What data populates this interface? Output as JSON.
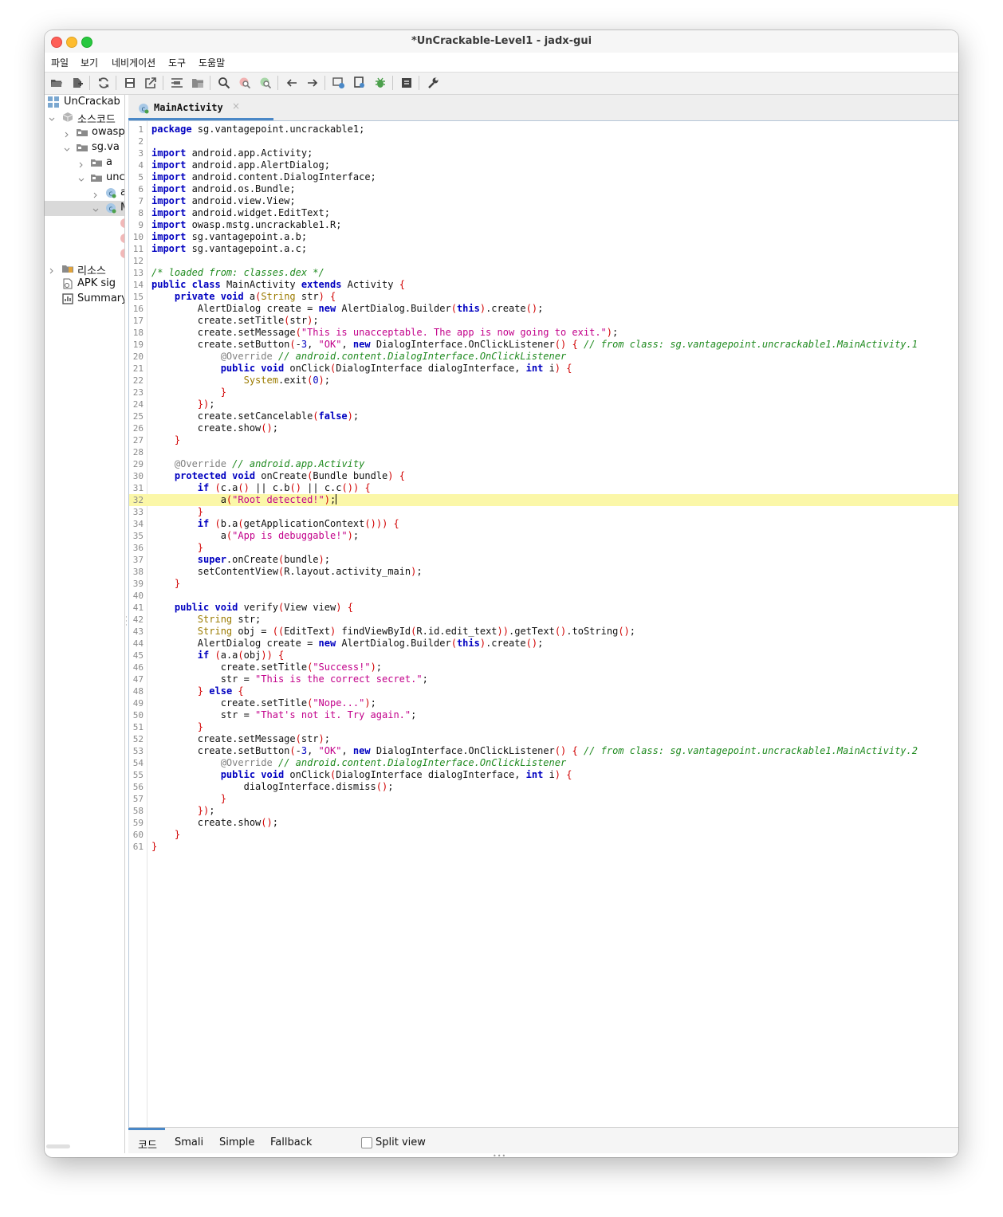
{
  "window": {
    "title": "*UnCrackable-Level1 - jadx-gui"
  },
  "menu": [
    "파일",
    "보기",
    "네비게이션",
    "도구",
    "도움말"
  ],
  "toolbar_icons": [
    "open-file-icon",
    "add-file-icon",
    "sync-icon",
    "save-icon",
    "export-icon",
    "sync-tree-icon",
    "flatten-packages-icon",
    "search-icon",
    "find-usage-icon",
    "text-search-icon",
    "back-icon",
    "forward-icon",
    "deobfuscation-icon",
    "quark-icon",
    "debug-icon",
    "log-icon",
    "settings-icon"
  ],
  "tree": [
    {
      "label": "UnCrackab",
      "icon": "project-icon"
    },
    {
      "label": "소스코드",
      "icon": "package-cube-icon"
    },
    {
      "label": "owasp",
      "icon": "folder-icon"
    },
    {
      "label": "sg.va",
      "icon": "folder-icon"
    },
    {
      "label": "a",
      "icon": "folder-icon"
    },
    {
      "label": "unc",
      "icon": "folder-icon"
    },
    {
      "label": "a",
      "icon": "class-icon"
    },
    {
      "label": "M",
      "icon": "class-icon"
    },
    {
      "label": "리소스",
      "icon": "resources-icon"
    },
    {
      "label": "APK sig",
      "icon": "signature-icon"
    },
    {
      "label": "Summary",
      "icon": "summary-icon"
    }
  ],
  "editor_tab": {
    "label": "MainActivity",
    "close": "×"
  },
  "code_lines": [
    "package sg.vantagepoint.uncrackable1;",
    "",
    "import android.app.Activity;",
    "import android.app.AlertDialog;",
    "import android.content.DialogInterface;",
    "import android.os.Bundle;",
    "import android.view.View;",
    "import android.widget.EditText;",
    "import owasp.mstg.uncrackable1.R;",
    "import sg.vantagepoint.a.b;",
    "import sg.vantagepoint.a.c;",
    "",
    "/* loaded from: classes.dex */",
    "public class MainActivity extends Activity {",
    "    private void a(String str) {",
    "        AlertDialog create = new AlertDialog.Builder(this).create();",
    "        create.setTitle(str);",
    "        create.setMessage(\"This is unacceptable. The app is now going to exit.\");",
    "        create.setButton(-3, \"OK\", new DialogInterface.OnClickListener() { // from class: sg.vantagepoint.uncrackable1.MainActivity.1",
    "            @Override // android.content.DialogInterface.OnClickListener",
    "            public void onClick(DialogInterface dialogInterface, int i) {",
    "                System.exit(0);",
    "            }",
    "        });",
    "        create.setCancelable(false);",
    "        create.show();",
    "    }",
    "",
    "    @Override // android.app.Activity",
    "    protected void onCreate(Bundle bundle) {",
    "        if (c.a() || c.b() || c.c()) {",
    "            a(\"Root detected!\");",
    "        }",
    "        if (b.a(getApplicationContext())) {",
    "            a(\"App is debuggable!\");",
    "        }",
    "        super.onCreate(bundle);",
    "        setContentView(R.layout.activity_main);",
    "    }",
    "",
    "    public void verify(View view) {",
    "        String str;",
    "        String obj = ((EditText) findViewById(R.id.edit_text)).getText().toString();",
    "        AlertDialog create = new AlertDialog.Builder(this).create();",
    "        if (a.a(obj)) {",
    "            create.setTitle(\"Success!\");",
    "            str = \"This is the correct secret.\";",
    "        } else {",
    "            create.setTitle(\"Nope...\");",
    "            str = \"That's not it. Try again.\";",
    "        }",
    "        create.setMessage(str);",
    "        create.setButton(-3, \"OK\", new DialogInterface.OnClickListener() { // from class: sg.vantagepoint.uncrackable1.MainActivity.2",
    "            @Override // android.content.DialogInterface.OnClickListener",
    "            public void onClick(DialogInterface dialogInterface, int i) {",
    "                dialogInterface.dismiss();",
    "            }",
    "        });",
    "        create.show();",
    "    }",
    "}"
  ],
  "highlighted_line": 32,
  "bottom_tabs": [
    "코드",
    "Smali",
    "Simple",
    "Fallback"
  ],
  "split_view": {
    "label": "Split view",
    "checked": false
  },
  "colors": {
    "keyword": "#0000c0",
    "string": "#c2008a",
    "comment": "#1f8a1f",
    "annotation": "#808080",
    "highlight": "#fbf7a8",
    "accent": "#4a88c7"
  }
}
